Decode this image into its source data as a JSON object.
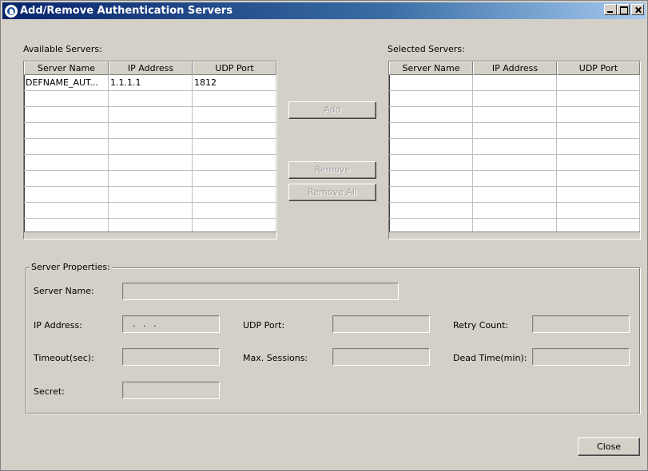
{
  "window": {
    "title": "Add/Remove Authentication Servers"
  },
  "available": {
    "label": "Available Servers:",
    "columns": [
      "Server Name",
      "IP Address",
      "UDP Port"
    ],
    "rows": [
      [
        "DEFNAME_AUT...",
        "1.1.1.1",
        "1812"
      ],
      [
        "",
        "",
        ""
      ],
      [
        "",
        "",
        ""
      ],
      [
        "",
        "",
        ""
      ],
      [
        "",
        "",
        ""
      ],
      [
        "",
        "",
        ""
      ],
      [
        "",
        "",
        ""
      ],
      [
        "",
        "",
        ""
      ],
      [
        "",
        "",
        ""
      ],
      [
        "",
        "",
        ""
      ]
    ]
  },
  "selected": {
    "label": "Selected Servers:",
    "columns": [
      "Server Name",
      "IP Address",
      "UDP Port"
    ],
    "rows": [
      [
        "",
        "",
        ""
      ],
      [
        "",
        "",
        ""
      ],
      [
        "",
        "",
        ""
      ],
      [
        "",
        "",
        ""
      ],
      [
        "",
        "",
        ""
      ],
      [
        "",
        "",
        ""
      ],
      [
        "",
        "",
        ""
      ],
      [
        "",
        "",
        ""
      ],
      [
        "",
        "",
        ""
      ],
      [
        "",
        "",
        ""
      ]
    ]
  },
  "actions": {
    "add": "Add",
    "remove": "Remove",
    "remove_all": "Remove All",
    "close": "Close"
  },
  "properties": {
    "legend": "Server Properties:",
    "server_name_label": "Server Name:",
    "server_name_value": "",
    "ip_address_label": "IP Address:",
    "ip_address_value": ". . .",
    "udp_port_label": "UDP Port:",
    "udp_port_value": "",
    "retry_count_label": "Retry Count:",
    "retry_count_value": "",
    "timeout_label": "Timeout(sec):",
    "timeout_value": "",
    "max_sessions_label": "Max. Sessions:",
    "max_sessions_value": "",
    "dead_time_label": "Dead Time(min):",
    "dead_time_value": "",
    "secret_label": "Secret:",
    "secret_value": ""
  },
  "colors": {
    "window_bg": "#d4d0c8",
    "titlebar_start": "#08246b",
    "titlebar_end": "#a6caf0",
    "disabled_text": "#a0a0a0"
  }
}
